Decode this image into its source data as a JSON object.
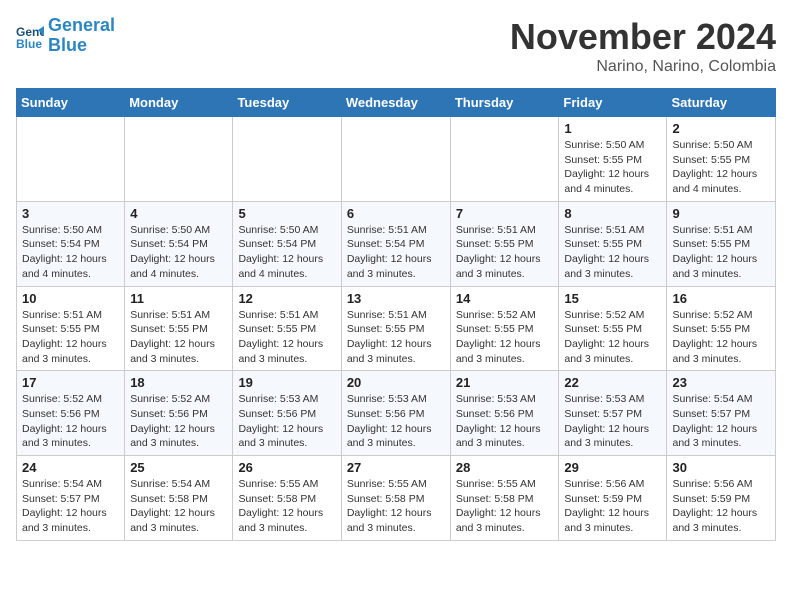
{
  "logo": {
    "line1": "General",
    "line2": "Blue"
  },
  "title": "November 2024",
  "location": "Narino, Narino, Colombia",
  "days_of_week": [
    "Sunday",
    "Monday",
    "Tuesday",
    "Wednesday",
    "Thursday",
    "Friday",
    "Saturday"
  ],
  "weeks": [
    [
      {
        "day": "",
        "info": ""
      },
      {
        "day": "",
        "info": ""
      },
      {
        "day": "",
        "info": ""
      },
      {
        "day": "",
        "info": ""
      },
      {
        "day": "",
        "info": ""
      },
      {
        "day": "1",
        "info": "Sunrise: 5:50 AM\nSunset: 5:55 PM\nDaylight: 12 hours and 4 minutes."
      },
      {
        "day": "2",
        "info": "Sunrise: 5:50 AM\nSunset: 5:55 PM\nDaylight: 12 hours and 4 minutes."
      }
    ],
    [
      {
        "day": "3",
        "info": "Sunrise: 5:50 AM\nSunset: 5:54 PM\nDaylight: 12 hours and 4 minutes."
      },
      {
        "day": "4",
        "info": "Sunrise: 5:50 AM\nSunset: 5:54 PM\nDaylight: 12 hours and 4 minutes."
      },
      {
        "day": "5",
        "info": "Sunrise: 5:50 AM\nSunset: 5:54 PM\nDaylight: 12 hours and 4 minutes."
      },
      {
        "day": "6",
        "info": "Sunrise: 5:51 AM\nSunset: 5:54 PM\nDaylight: 12 hours and 3 minutes."
      },
      {
        "day": "7",
        "info": "Sunrise: 5:51 AM\nSunset: 5:55 PM\nDaylight: 12 hours and 3 minutes."
      },
      {
        "day": "8",
        "info": "Sunrise: 5:51 AM\nSunset: 5:55 PM\nDaylight: 12 hours and 3 minutes."
      },
      {
        "day": "9",
        "info": "Sunrise: 5:51 AM\nSunset: 5:55 PM\nDaylight: 12 hours and 3 minutes."
      }
    ],
    [
      {
        "day": "10",
        "info": "Sunrise: 5:51 AM\nSunset: 5:55 PM\nDaylight: 12 hours and 3 minutes."
      },
      {
        "day": "11",
        "info": "Sunrise: 5:51 AM\nSunset: 5:55 PM\nDaylight: 12 hours and 3 minutes."
      },
      {
        "day": "12",
        "info": "Sunrise: 5:51 AM\nSunset: 5:55 PM\nDaylight: 12 hours and 3 minutes."
      },
      {
        "day": "13",
        "info": "Sunrise: 5:51 AM\nSunset: 5:55 PM\nDaylight: 12 hours and 3 minutes."
      },
      {
        "day": "14",
        "info": "Sunrise: 5:52 AM\nSunset: 5:55 PM\nDaylight: 12 hours and 3 minutes."
      },
      {
        "day": "15",
        "info": "Sunrise: 5:52 AM\nSunset: 5:55 PM\nDaylight: 12 hours and 3 minutes."
      },
      {
        "day": "16",
        "info": "Sunrise: 5:52 AM\nSunset: 5:55 PM\nDaylight: 12 hours and 3 minutes."
      }
    ],
    [
      {
        "day": "17",
        "info": "Sunrise: 5:52 AM\nSunset: 5:56 PM\nDaylight: 12 hours and 3 minutes."
      },
      {
        "day": "18",
        "info": "Sunrise: 5:52 AM\nSunset: 5:56 PM\nDaylight: 12 hours and 3 minutes."
      },
      {
        "day": "19",
        "info": "Sunrise: 5:53 AM\nSunset: 5:56 PM\nDaylight: 12 hours and 3 minutes."
      },
      {
        "day": "20",
        "info": "Sunrise: 5:53 AM\nSunset: 5:56 PM\nDaylight: 12 hours and 3 minutes."
      },
      {
        "day": "21",
        "info": "Sunrise: 5:53 AM\nSunset: 5:56 PM\nDaylight: 12 hours and 3 minutes."
      },
      {
        "day": "22",
        "info": "Sunrise: 5:53 AM\nSunset: 5:57 PM\nDaylight: 12 hours and 3 minutes."
      },
      {
        "day": "23",
        "info": "Sunrise: 5:54 AM\nSunset: 5:57 PM\nDaylight: 12 hours and 3 minutes."
      }
    ],
    [
      {
        "day": "24",
        "info": "Sunrise: 5:54 AM\nSunset: 5:57 PM\nDaylight: 12 hours and 3 minutes."
      },
      {
        "day": "25",
        "info": "Sunrise: 5:54 AM\nSunset: 5:58 PM\nDaylight: 12 hours and 3 minutes."
      },
      {
        "day": "26",
        "info": "Sunrise: 5:55 AM\nSunset: 5:58 PM\nDaylight: 12 hours and 3 minutes."
      },
      {
        "day": "27",
        "info": "Sunrise: 5:55 AM\nSunset: 5:58 PM\nDaylight: 12 hours and 3 minutes."
      },
      {
        "day": "28",
        "info": "Sunrise: 5:55 AM\nSunset: 5:58 PM\nDaylight: 12 hours and 3 minutes."
      },
      {
        "day": "29",
        "info": "Sunrise: 5:56 AM\nSunset: 5:59 PM\nDaylight: 12 hours and 3 minutes."
      },
      {
        "day": "30",
        "info": "Sunrise: 5:56 AM\nSunset: 5:59 PM\nDaylight: 12 hours and 3 minutes."
      }
    ]
  ]
}
